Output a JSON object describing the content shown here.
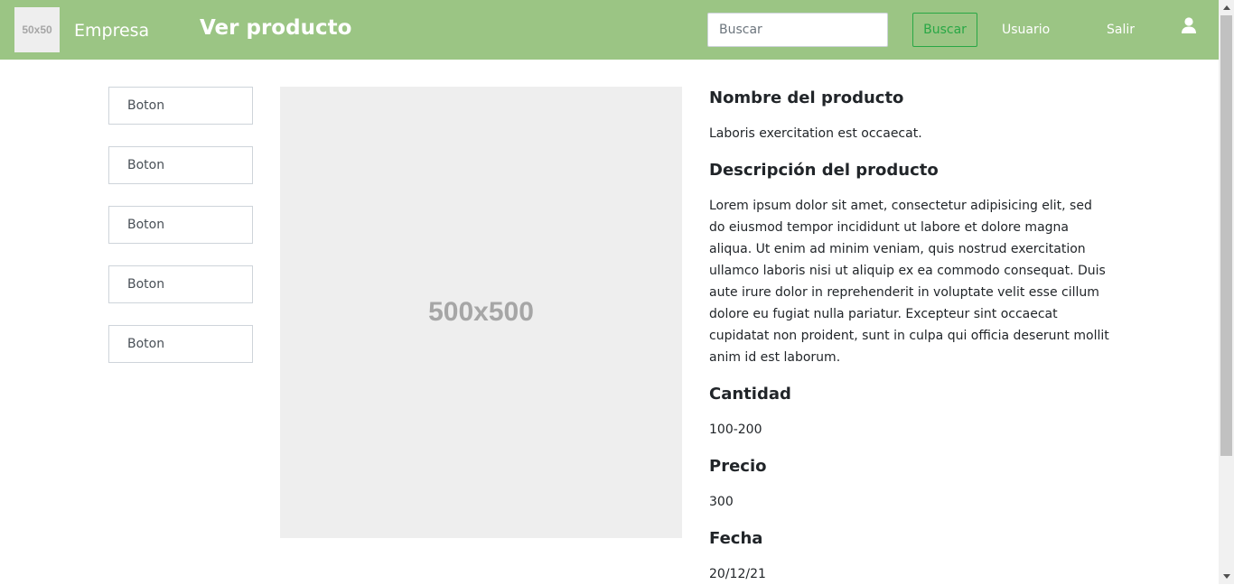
{
  "header": {
    "logo_text": "50x50",
    "brand": "Empresa",
    "page_title": "Ver producto",
    "search": {
      "placeholder": "Buscar",
      "button_label": "Buscar"
    },
    "links": {
      "user": "Usuario",
      "logout": "Salir"
    },
    "user_icon": "user-icon",
    "background_color": "#9bc584"
  },
  "sidebar": {
    "buttons": [
      "Boton",
      "Boton",
      "Boton",
      "Boton",
      "Boton"
    ]
  },
  "product": {
    "image_placeholder": "500x500",
    "name_heading": "Nombre del producto",
    "name": "Laboris exercitation est occaecat.",
    "description_heading": "Descripción del producto",
    "description": "Lorem ipsum dolor sit amet, consectetur adipisicing elit, sed do eiusmod tempor incididunt ut labore et dolore magna aliqua. Ut enim ad minim veniam, quis nostrud exercitation ullamco laboris nisi ut aliquip ex ea commodo consequat. Duis aute irure dolor in reprehenderit in voluptate velit esse cillum dolore eu fugiat nulla pariatur. Excepteur sint occaecat cupidatat non proident, sunt in culpa qui officia deserunt mollit anim id est laborum.",
    "quantity_heading": "Cantidad",
    "quantity": "100-200",
    "price_heading": "Precio",
    "price": "300",
    "date_heading": "Fecha",
    "date": "20/12/21"
  }
}
